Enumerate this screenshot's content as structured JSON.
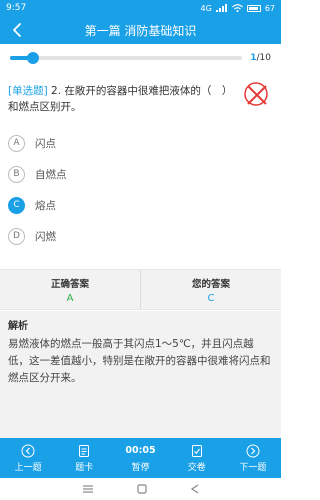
{
  "status": {
    "time": "9:57",
    "signal": "4G",
    "battery": "67"
  },
  "nav": {
    "title": "第一篇 消防基础知识"
  },
  "progress": {
    "current": "1",
    "total": "/10",
    "fraction": 0.1
  },
  "question": {
    "type": "[单选题]",
    "text": " 2. 在敞开的容器中很难把液体的（　）和燃点区别开。"
  },
  "options": [
    {
      "letter": "A",
      "text": "闪点",
      "selected": false
    },
    {
      "letter": "B",
      "text": "自燃点",
      "selected": false
    },
    {
      "letter": "C",
      "text": "熔点",
      "selected": true
    },
    {
      "letter": "D",
      "text": "闪燃",
      "selected": false
    }
  ],
  "answers": {
    "correct_label": "正确答案",
    "correct_value": "A",
    "mine_label": "您的答案",
    "mine_value": "C"
  },
  "analysis": {
    "title": "解析",
    "text": "易燃液体的燃点一般高于其闪点1～5℃，并且闪点越低，这一差值越小，特别是在敞开的容器中很难将闪点和燃点区分开来。"
  },
  "bottom": {
    "prev": "上一题",
    "card": "题卡",
    "timer": "00:05",
    "pause": "暂停",
    "submit": "交卷",
    "next": "下一题"
  },
  "colors": {
    "accent": "#1aa0e6",
    "correct": "#2bb24c",
    "wrong": "#e53935"
  }
}
